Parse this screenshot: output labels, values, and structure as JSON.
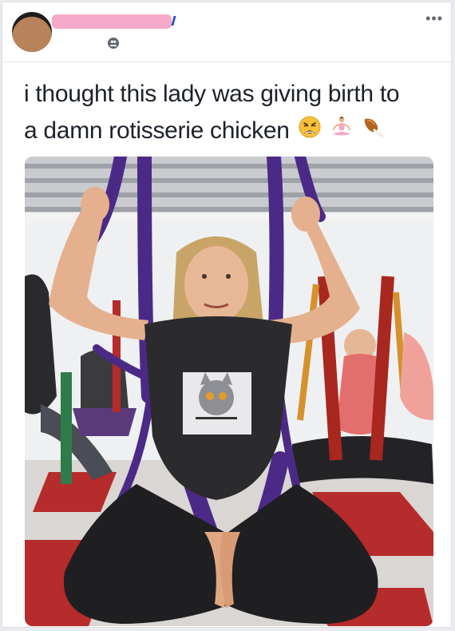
{
  "post": {
    "author_name": "",
    "text_line1": "i thought this lady was giving birth to",
    "text_line2": "a damn rotisserie chicken",
    "emojis": [
      "weary-face-emoji",
      "person-in-lotus-position-emoji",
      "poultry-leg-emoji"
    ]
  },
  "header": {
    "privacy_icon": "friends-icon",
    "more_icon": "more-options-icon",
    "more_label": "•••"
  },
  "photo": {
    "subject": "aerial-yoga-class-photo"
  },
  "colors": {
    "card_bg": "#ffffff",
    "page_bg": "#e9ebee",
    "text": "#1d2129",
    "redaction": "#f6a9c9",
    "hammock_purple": "#4a2a86",
    "hammock_red": "#b42a24"
  }
}
